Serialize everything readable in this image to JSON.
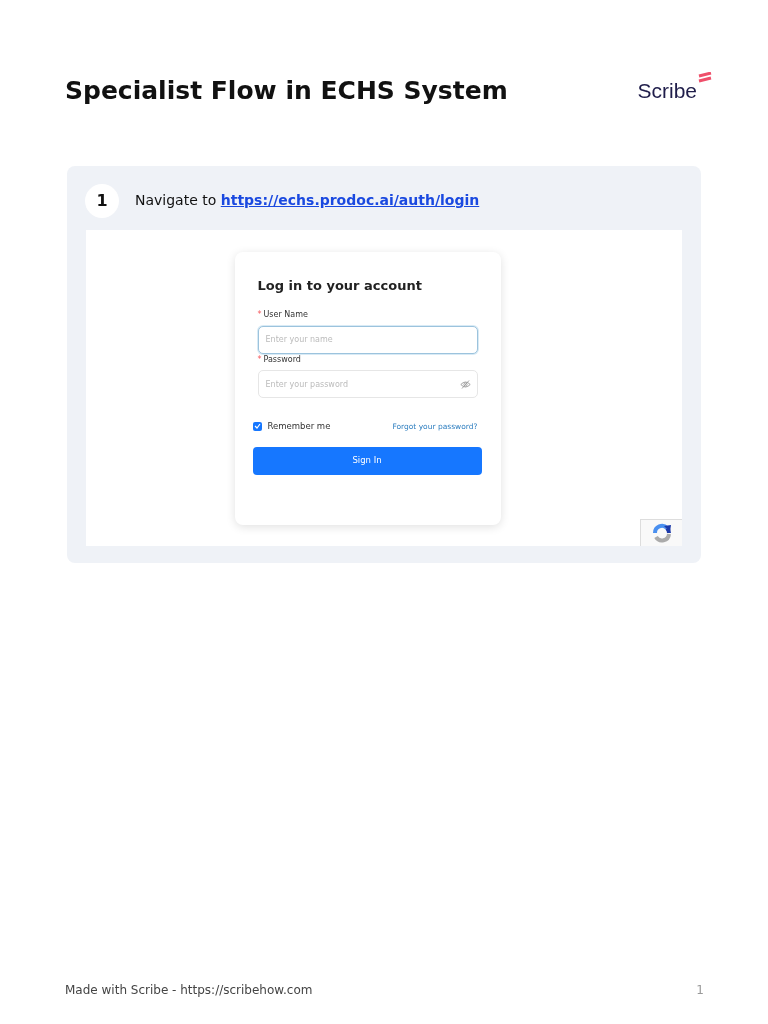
{
  "title": "Specialist Flow in ECHS System",
  "logo": "Scribe",
  "steps": [
    {
      "number": "1",
      "text": "Navigate to",
      "link": "https://echs.prodoc.ai/auth/login",
      "screenshot": {
        "heading": "Log in to your account",
        "fields": [
          {
            "label": "User Name",
            "required_mark": "*",
            "placeholder": "Enter your name",
            "focused": true,
            "kind": "text"
          },
          {
            "label": "Password",
            "required_mark": "*",
            "placeholder": "Enter your password",
            "focused": false,
            "kind": "password"
          }
        ],
        "remember": {
          "label": "Remember me",
          "checked": true
        },
        "forgot": "Forgot your password?",
        "button": "Sign In"
      }
    }
  ],
  "footer": {
    "text": "Made with Scribe - https://scribehow.com",
    "page": "1"
  }
}
